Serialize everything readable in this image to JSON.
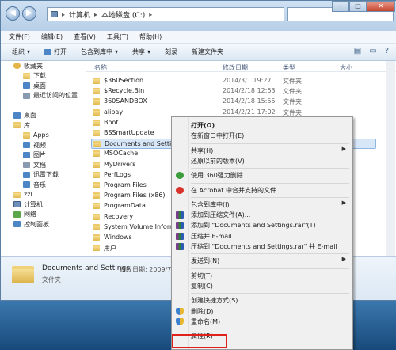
{
  "address": {
    "crumbs": [
      "计算机",
      "本地磁盘 (C:)"
    ]
  },
  "menubar": [
    "文件(F)",
    "编辑(E)",
    "查看(V)",
    "工具(T)",
    "帮助(H)"
  ],
  "toolbar": [
    "组织",
    "打开",
    "包含到库中",
    "共享",
    "刻录",
    "新建文件夹"
  ],
  "sidebar": [
    {
      "label": "收藏夹",
      "icon": "star-icon",
      "indent": 0
    },
    {
      "label": "下载",
      "icon": "folder-icon",
      "indent": 1
    },
    {
      "label": "桌面",
      "icon": "desktop-icon",
      "indent": 1
    },
    {
      "label": "最近访问的位置",
      "icon": "recent-icon",
      "indent": 1
    },
    {
      "label": "",
      "icon": "",
      "indent": 0
    },
    {
      "label": "桌面",
      "icon": "desktop-icon",
      "indent": 0
    },
    {
      "label": "库",
      "icon": "library-icon",
      "indent": 0
    },
    {
      "label": "Apps",
      "icon": "folder-icon",
      "indent": 1
    },
    {
      "label": "视频",
      "icon": "video-icon",
      "indent": 1
    },
    {
      "label": "图片",
      "icon": "picture-icon",
      "indent": 1
    },
    {
      "label": "文档",
      "icon": "document-icon",
      "indent": 1
    },
    {
      "label": "迅雷下载",
      "icon": "download-icon",
      "indent": 1
    },
    {
      "label": "音乐",
      "icon": "music-icon",
      "indent": 1
    },
    {
      "label": "zzl",
      "icon": "user-icon",
      "indent": 0
    },
    {
      "label": "计算机",
      "icon": "computer-icon",
      "indent": 0
    },
    {
      "label": "网络",
      "icon": "network-icon",
      "indent": 0
    },
    {
      "label": "控制面板",
      "icon": "control-panel-icon",
      "indent": 0
    }
  ],
  "columns": {
    "name": "名称",
    "date": "修改日期",
    "type": "类型",
    "size": "大小"
  },
  "files": [
    {
      "name": "$360Section",
      "date": "2014/3/1 19:27",
      "type": "文件夹"
    },
    {
      "name": "$Recycle.Bin",
      "date": "2014/2/18 12:53",
      "type": "文件夹"
    },
    {
      "name": "360SANDBOX",
      "date": "2014/2/18 15:55",
      "type": "文件夹"
    },
    {
      "name": "alipay",
      "date": "2014/2/21 17:02",
      "type": "文件夹"
    },
    {
      "name": "Boot",
      "date": "",
      "type": ""
    },
    {
      "name": "BSSmartUpdate",
      "date": "",
      "type": ""
    },
    {
      "name": "Documents and Settings",
      "date": "",
      "type": ""
    },
    {
      "name": "MSOCache",
      "date": "",
      "type": ""
    },
    {
      "name": "MyDrivers",
      "date": "",
      "type": ""
    },
    {
      "name": "PerfLogs",
      "date": "",
      "type": ""
    },
    {
      "name": "Program Files",
      "date": "",
      "type": ""
    },
    {
      "name": "Program Files (x86)",
      "date": "",
      "type": ""
    },
    {
      "name": "ProgramData",
      "date": "",
      "type": ""
    },
    {
      "name": "Recovery",
      "date": "",
      "type": ""
    },
    {
      "name": "System Volume Informati",
      "date": "",
      "type": ""
    },
    {
      "name": "Windows",
      "date": "",
      "type": ""
    },
    {
      "name": "用户",
      "date": "",
      "type": ""
    }
  ],
  "details": {
    "name": "Documents and Settings",
    "date": "修改日期: 2009/7/1",
    "type": "文件夹"
  },
  "context_menu": [
    {
      "label": "打开(O)",
      "bold": true
    },
    {
      "label": "在新窗口中打开(E)"
    },
    {
      "sep": true
    },
    {
      "label": "共享(H)",
      "submenu": true
    },
    {
      "label": "还原以前的版本(V)"
    },
    {
      "sep": true
    },
    {
      "label": "使用 360强力删除",
      "icon": "q360"
    },
    {
      "sep": true
    },
    {
      "label": "在 Acrobat 中合并支持的文件...",
      "icon": "acrobat"
    },
    {
      "sep": true
    },
    {
      "label": "包含到库中(I)",
      "submenu": true
    },
    {
      "label": "添加到压缩文件(A)...",
      "icon": "rar"
    },
    {
      "label": "添加到 \"Documents and Settings.rar\"(T)",
      "icon": "rar"
    },
    {
      "label": "压缩并 E-mail...",
      "icon": "rar"
    },
    {
      "label": "压缩到 \"Documents and Settings.rar\" 并 E-mail",
      "icon": "rar"
    },
    {
      "sep": true
    },
    {
      "label": "发送到(N)",
      "submenu": true
    },
    {
      "sep": true
    },
    {
      "label": "剪切(T)"
    },
    {
      "label": "复制(C)"
    },
    {
      "sep": true
    },
    {
      "label": "创建快捷方式(S)"
    },
    {
      "label": "删除(D)",
      "icon": "shield"
    },
    {
      "label": "重命名(M)",
      "icon": "shield"
    },
    {
      "sep": true
    },
    {
      "label": "属性(R)"
    }
  ]
}
